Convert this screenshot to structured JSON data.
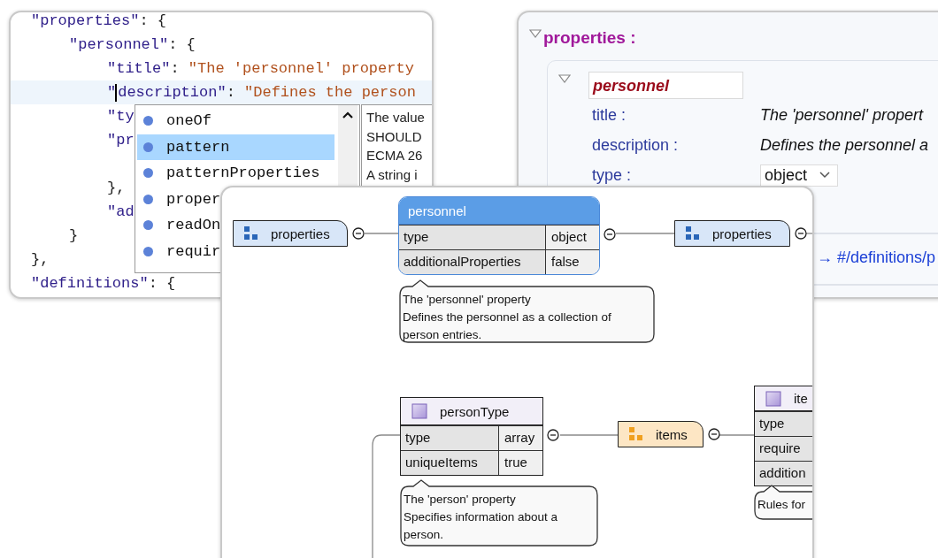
{
  "code_editor": {
    "lines": [
      {
        "current": false,
        "tokens": [
          {
            "text": "\"properties\"",
            "kind": "key"
          },
          {
            "text": ": {",
            "kind": "punct"
          }
        ],
        "children": [
          {
            "current": false,
            "tokens": [
              {
                "text": "\"personnel\"",
                "kind": "key"
              },
              {
                "text": ": {",
                "kind": "punct"
              }
            ],
            "children": [
              {
                "current": false,
                "tokens": [
                  {
                    "text": "\"title\"",
                    "kind": "key"
                  },
                  {
                    "text": ": ",
                    "kind": "punct"
                  },
                  {
                    "text": "\"The 'personnel' property",
                    "kind": "string"
                  }
                ]
              },
              {
                "current": true,
                "tokens": [
                  {
                    "text": "\"",
                    "kind": "key"
                  },
                  {
                    "text": "description\"",
                    "kind": "key",
                    "caret_before": true
                  },
                  {
                    "text": ": ",
                    "kind": "punct"
                  },
                  {
                    "text": "\"Defines the person",
                    "kind": "string"
                  }
                ]
              },
              {
                "current": false,
                "tokens": [
                  {
                    "text": "\"ty",
                    "kind": "key"
                  }
                ]
              },
              {
                "current": false,
                "wraps": true,
                "tokens": [
                  {
                    "text": "\"pr",
                    "kind": "key"
                  }
                ]
              },
              {
                "current": false,
                "tokens": [
                  {
                    "text": "},",
                    "kind": "punct"
                  }
                ]
              },
              {
                "current": false,
                "tokens": [
                  {
                    "text": "\"ad",
                    "kind": "key"
                  }
                ]
              }
            ]
          },
          {
            "current": false,
            "tokens": [
              {
                "text": "}",
                "kind": "punct"
              }
            ]
          }
        ]
      },
      {
        "current": false,
        "tokens": [
          {
            "text": "},",
            "kind": "punct"
          }
        ]
      },
      {
        "current": false,
        "tokens": [
          {
            "text": "\"definitions\"",
            "kind": "key"
          },
          {
            "text": ": {",
            "kind": "punct"
          }
        ]
      }
    ]
  },
  "completion_popup": {
    "items": [
      {
        "label": "oneOf",
        "selected": false
      },
      {
        "label": "pattern",
        "selected": true
      },
      {
        "label": "patternProperties",
        "selected": false
      },
      {
        "label": "proper",
        "selected": false
      },
      {
        "label": "readOn",
        "selected": false
      },
      {
        "label": "requir",
        "selected": false
      }
    ],
    "documentation": [
      "The value",
      "SHOULD",
      "ECMA 26",
      "A string i"
    ]
  },
  "form_view": {
    "heading": "properties :",
    "expanded": true,
    "property": {
      "name": "personnel",
      "expanded": true,
      "fields": [
        {
          "label": "title :",
          "value": "The 'personnel' propert",
          "kind": "text"
        },
        {
          "label": "description :",
          "value": "Defines the personnel a",
          "kind": "text"
        },
        {
          "label": "type :",
          "value": "object",
          "kind": "select"
        }
      ],
      "reference": "→ #/definitions/p"
    }
  },
  "diagram": {
    "nodes": [
      {
        "kind": "property-group",
        "label": "properties",
        "expanded": true
      },
      {
        "kind": "table",
        "title": "personnel",
        "selected": true,
        "expanded": true,
        "rows": [
          {
            "name": "type",
            "value": "object"
          },
          {
            "name": "additionalProperties",
            "value": "false"
          }
        ]
      },
      {
        "kind": "property-group",
        "label": "properties",
        "expanded": true
      },
      {
        "kind": "callout",
        "lines": [
          "The 'personnel' property",
          "Defines the personnel as a collection of person entries."
        ]
      },
      {
        "kind": "table",
        "title": "personType",
        "selected": false,
        "expanded": true,
        "rows": [
          {
            "name": "type",
            "value": "array"
          },
          {
            "name": "uniqueItems",
            "value": "true"
          }
        ]
      },
      {
        "kind": "items-group",
        "label": "items",
        "expanded": true
      },
      {
        "kind": "table",
        "title": "ite",
        "selected": false,
        "rows": [
          {
            "name": "type"
          },
          {
            "name": "require"
          },
          {
            "name": "addition"
          }
        ]
      },
      {
        "kind": "callout",
        "lines": [
          "The 'person' property",
          "Specifies information about a person."
        ]
      },
      {
        "kind": "callout",
        "lines": [
          "Rules for"
        ]
      }
    ]
  }
}
